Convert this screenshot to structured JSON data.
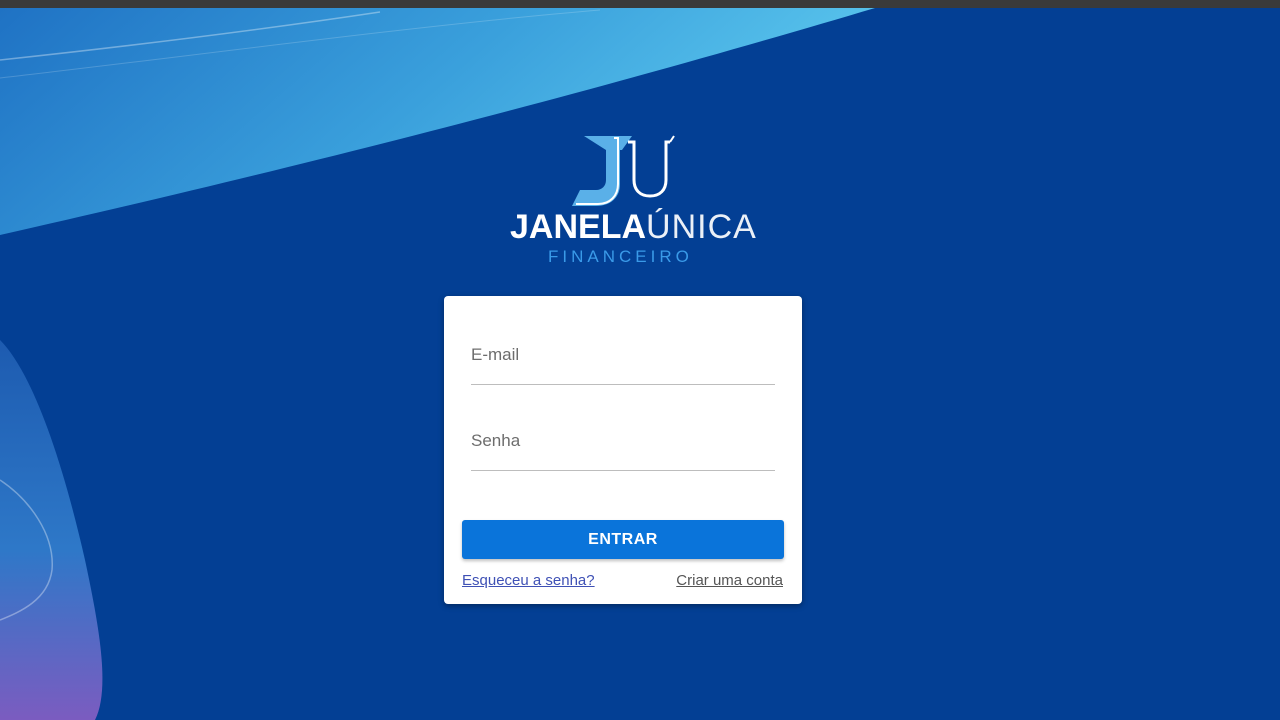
{
  "brand": {
    "title_bold": "JANELA",
    "title_thin": "ÚNICA",
    "subtitle": "FINANCEIRO"
  },
  "login": {
    "email_placeholder": "E-mail",
    "password_placeholder": "Senha",
    "submit_label": "ENTRAR",
    "forgot_password_label": "Esqueceu a senha?",
    "create_account_label": "Criar uma conta"
  },
  "colors": {
    "background": "#033f94",
    "accent": "#0a74da",
    "subtitle": "#3a9ae8",
    "link_forgot": "#3f51b5",
    "link_create": "#555555"
  },
  "icons": {
    "logo_mark": "ju-logo-mark"
  }
}
